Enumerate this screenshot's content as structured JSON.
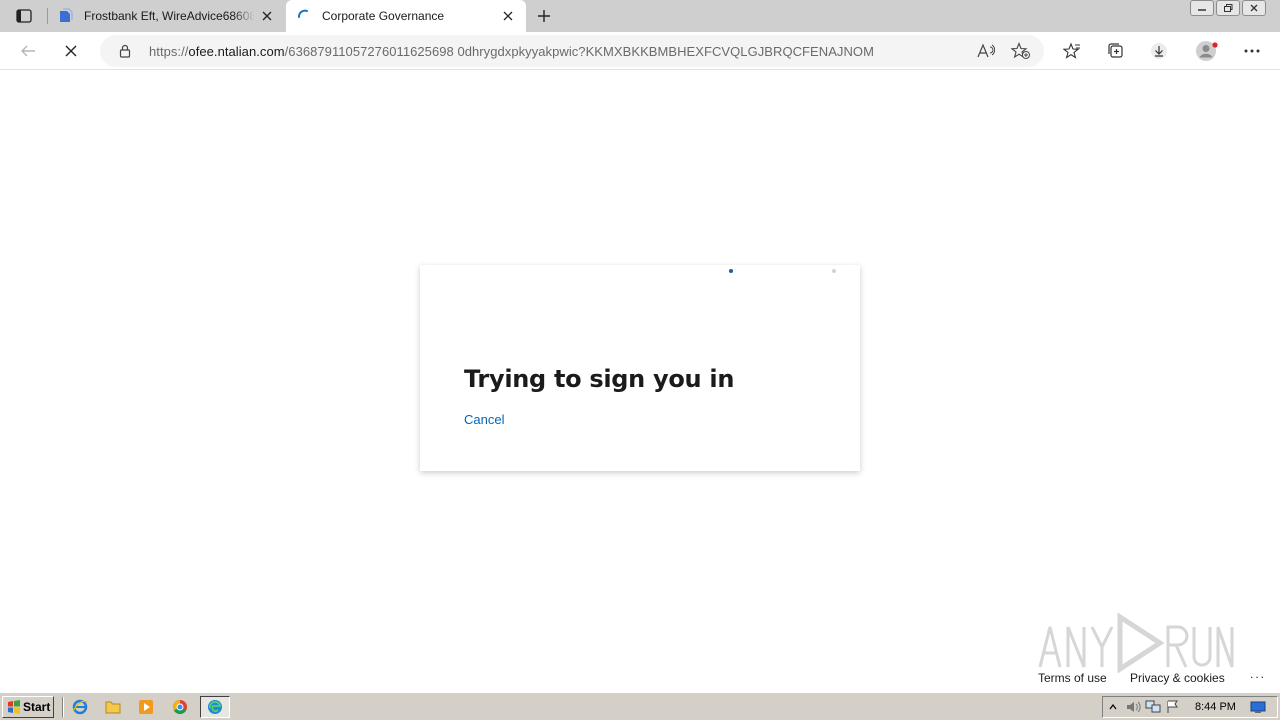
{
  "browser": {
    "tabs": [
      {
        "title": "Frostbank Eft, WireAdvice686086",
        "active": false
      },
      {
        "title": "Corporate Governance",
        "active": true
      }
    ],
    "address": {
      "url_prefix": "https://",
      "host": "ofee.ntalian.com",
      "path": "/63687911057276011625698 0dhrygdxpkyyakpwic?KKMXBKKBMBHEXFCVQLGJBRQCFENAJNOM"
    },
    "accent_color": "#0067b8"
  },
  "page": {
    "signin": {
      "title": "Trying to sign you in",
      "cancel_label": "Cancel"
    },
    "footer": {
      "terms_label": "Terms of use",
      "privacy_label": "Privacy & cookies",
      "more_label": "..."
    },
    "watermark_text": "ANY RUN"
  },
  "taskbar": {
    "start_label": "Start",
    "clock": "8:44 PM"
  }
}
